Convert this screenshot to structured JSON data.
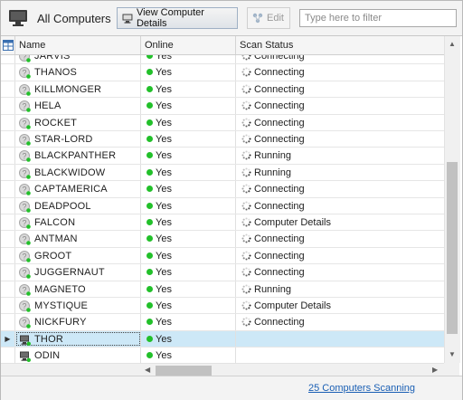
{
  "toolbar": {
    "title": "All Computers",
    "view_details_label": "View Computer Details",
    "edit_label": "Edit",
    "filter_placeholder": "Type here to filter",
    "filter_value": ""
  },
  "columns": [
    "Name",
    "Online",
    "Scan Status"
  ],
  "rows": [
    {
      "name": "JARVIS",
      "online": "Yes",
      "status": "Connecting"
    },
    {
      "name": "THANOS",
      "online": "Yes",
      "status": "Connecting"
    },
    {
      "name": "KILLMONGER",
      "online": "Yes",
      "status": "Connecting"
    },
    {
      "name": "HELA",
      "online": "Yes",
      "status": "Connecting"
    },
    {
      "name": "ROCKET",
      "online": "Yes",
      "status": "Connecting"
    },
    {
      "name": "STAR-LORD",
      "online": "Yes",
      "status": "Connecting"
    },
    {
      "name": "BLACKPANTHER",
      "online": "Yes",
      "status": "Running"
    },
    {
      "name": "BLACKWIDOW",
      "online": "Yes",
      "status": "Running"
    },
    {
      "name": "CAPTAMERICA",
      "online": "Yes",
      "status": "Connecting"
    },
    {
      "name": "DEADPOOL",
      "online": "Yes",
      "status": "Connecting"
    },
    {
      "name": "FALCON",
      "online": "Yes",
      "status": "Computer Details"
    },
    {
      "name": "ANTMAN",
      "online": "Yes",
      "status": "Connecting"
    },
    {
      "name": "GROOT",
      "online": "Yes",
      "status": "Connecting"
    },
    {
      "name": "JUGGERNAUT",
      "online": "Yes",
      "status": "Connecting"
    },
    {
      "name": "MAGNETO",
      "online": "Yes",
      "status": "Running"
    },
    {
      "name": "MYSTIQUE",
      "online": "Yes",
      "status": "Computer Details"
    },
    {
      "name": "NICKFURY",
      "online": "Yes",
      "status": "Connecting"
    },
    {
      "name": "THOR",
      "online": "Yes",
      "status": "",
      "selected": true
    },
    {
      "name": "ODIN",
      "online": "Yes",
      "status": ""
    }
  ],
  "status_bar": {
    "link": "25 Computers Scanning"
  },
  "colors": {
    "online_dot": "#22c02a",
    "selection": "#cde8f7",
    "link": "#1a5fb4"
  },
  "icons": {
    "toolbar": "monitor-icon",
    "view": "monitor-icon",
    "edit": "edit-nodes-icon",
    "row": "computer-status-icon",
    "status": "spinner-icon"
  }
}
